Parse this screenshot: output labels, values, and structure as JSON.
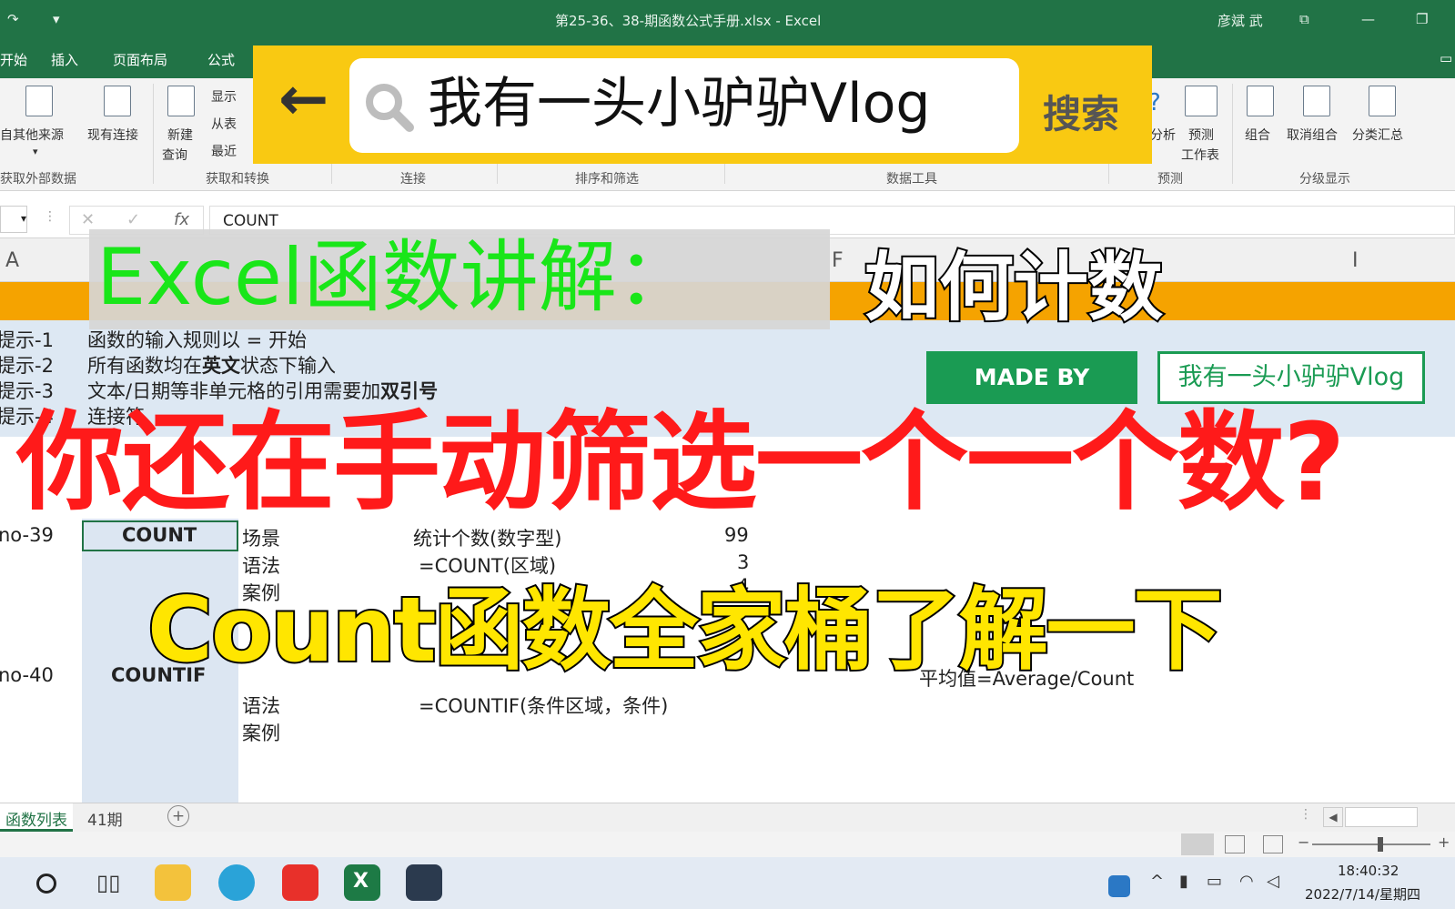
{
  "window": {
    "title": "第25-36、38-期函数公式手册.xlsx - Excel",
    "user": "彦斌 武"
  },
  "ribbon_tabs": [
    "开始",
    "插入",
    "页面布局",
    "公式"
  ],
  "ribbon": {
    "buttons": {
      "other_sources": "自其他来源",
      "existing_connections": "现有连接",
      "new_query_1": "新建",
      "new_query_2": "查询",
      "show": "显示",
      "from_table": "从表",
      "recent": "最近",
      "analysis": "分析",
      "forecast_1": "预测",
      "forecast_2": "工作表",
      "group": "组合",
      "ungroup": "取消组合",
      "subtotal": "分类汇总"
    },
    "groups": {
      "external_data": "获取外部数据",
      "get_transform": "获取和转换",
      "connections": "连接",
      "sort_filter": "排序和筛选",
      "data_tools": "数据工具",
      "forecast": "预测",
      "outline": "分级显示"
    }
  },
  "search": {
    "query": "我有一头小驴驴Vlog",
    "button": "搜索"
  },
  "formula_bar": {
    "value": "COUNT"
  },
  "columns": {
    "a": "A",
    "f": "F",
    "i": "I"
  },
  "overlay": {
    "heading_green": "Excel函数讲解：",
    "heading_white": "如何计数",
    "made_by": "MADE BY",
    "channel": "我有一头小驴驴Vlog",
    "headline_red": "你还在手动筛选一个一个数?",
    "headline_yellow": "Count函数全家桶了解一下"
  },
  "sheet": {
    "tips": [
      {
        "label": "提示-1",
        "text": "函数的输入规则以 = 开始"
      },
      {
        "label": "提示-2",
        "text_pre": "所有函数均在",
        "text_bold": "英文",
        "text_post": "状态下输入"
      },
      {
        "label": "提示-3",
        "text_pre": "文本/日期等非单元格的引用需要加",
        "text_bold": "双引号"
      },
      {
        "label": "提示-4",
        "text": "连接符"
      }
    ],
    "row39": {
      "no": "no-39",
      "func": "COUNT",
      "k1": "场景",
      "v1": "统计个数(数字型)",
      "n1": "99",
      "k2": "语法",
      "v2": "=COUNT(区域)",
      "n2": "3",
      "k3": "案例",
      "n3": "4"
    },
    "row40": {
      "no": "no-40",
      "func": "COUNTIF",
      "k2": "语法",
      "v2": "=COUNTIF(条件区域，条件)",
      "k3": "案例",
      "note": "平均值=Average/Count"
    }
  },
  "sheet_tabs": [
    "函数列表",
    "41期"
  ],
  "taskbar": {
    "time": "18:40:32",
    "date": "2022/7/14/星期四"
  }
}
